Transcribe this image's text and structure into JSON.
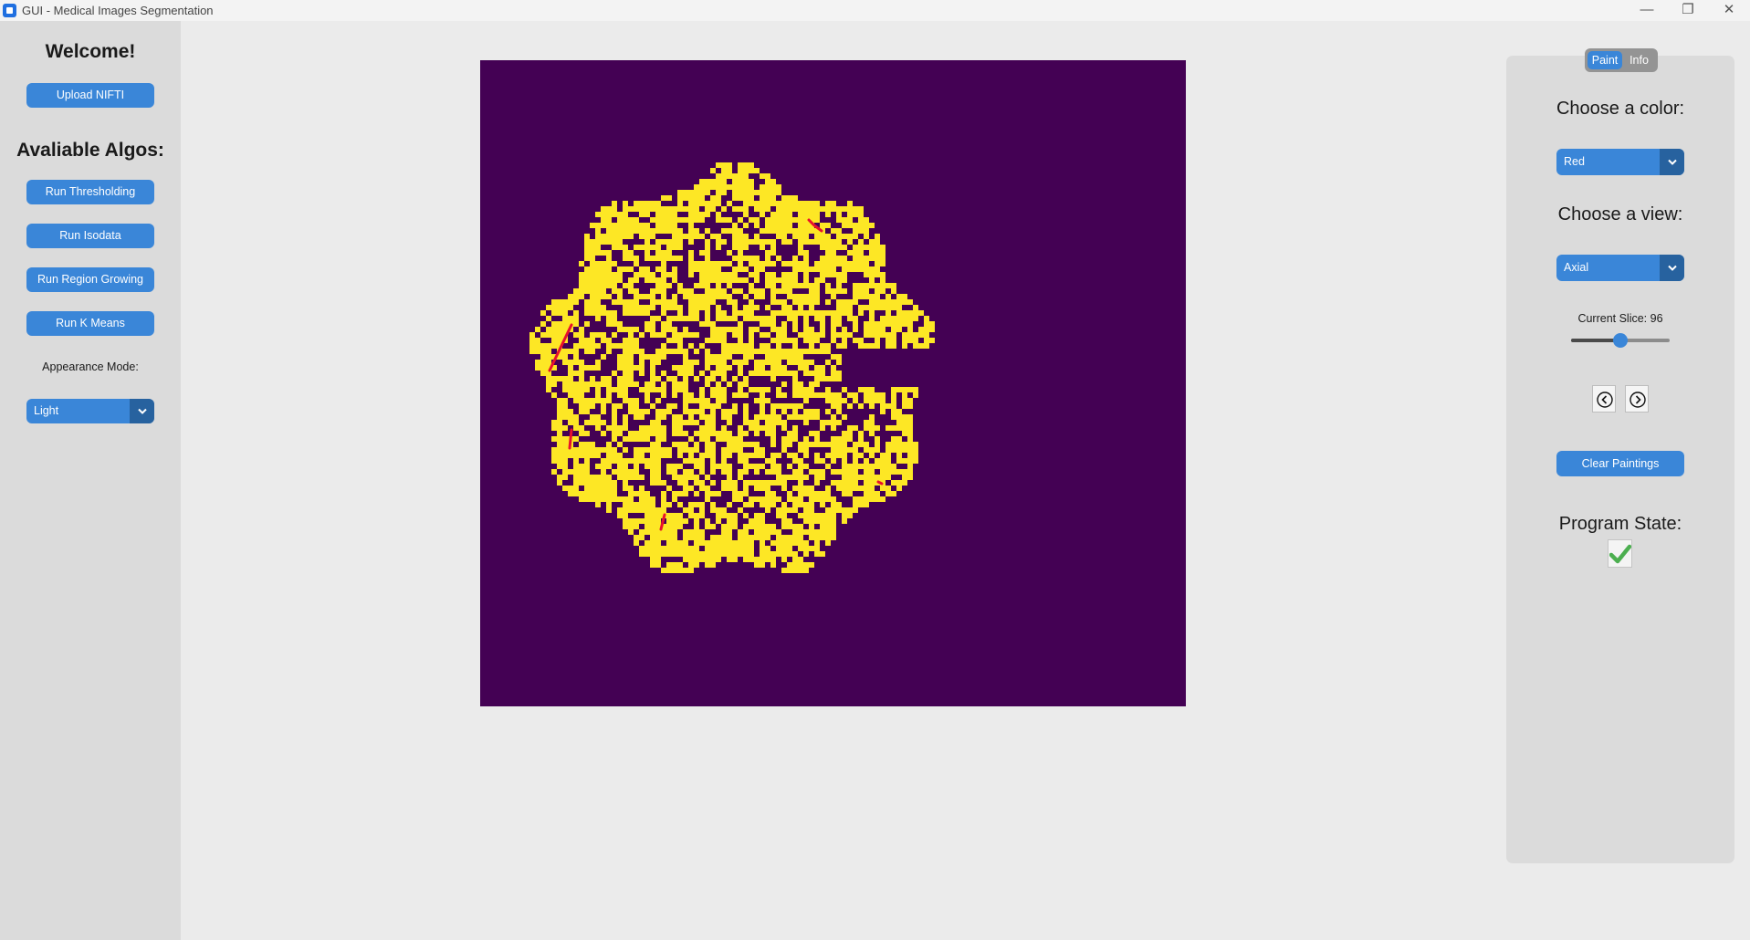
{
  "window": {
    "title": "GUI - Medical Images Segmentation",
    "minimize_icon": "minimize-icon",
    "restore_icon": "restore-icon",
    "close_icon": "close-icon"
  },
  "sidebar": {
    "welcome": "Welcome!",
    "upload_label": "Upload NIFTI",
    "algos_title": "Avaliable Algos:",
    "algos": [
      {
        "label": "Run Thresholding"
      },
      {
        "label": "Run Isodata"
      },
      {
        "label": "Run Region Growing"
      },
      {
        "label": "Run K Means"
      }
    ],
    "appearance_label": "Appearance Mode:",
    "appearance_value": "Light"
  },
  "viewer": {
    "background_color": "#440154",
    "segmentation_color": "#fde725",
    "paint_color": "#e8112d"
  },
  "panel": {
    "tabs": [
      {
        "label": "Paint",
        "active": true
      },
      {
        "label": "Info",
        "active": false
      }
    ],
    "color_heading": "Choose a color:",
    "color_value": "Red",
    "view_heading": "Choose a view:",
    "view_value": "Axial",
    "slice_label": "Current Slice: 96",
    "slice_level_fraction": 0.5,
    "prev_icon": "chevron-left-icon",
    "next_icon": "chevron-right-icon",
    "clear_label": "Clear Paintings",
    "state_heading": "Program State:",
    "state_icon": "checkmark-icon"
  },
  "colors": {
    "accent": "#3a86d8",
    "accent_dark": "#27629f",
    "check_green": "#4caf50"
  }
}
